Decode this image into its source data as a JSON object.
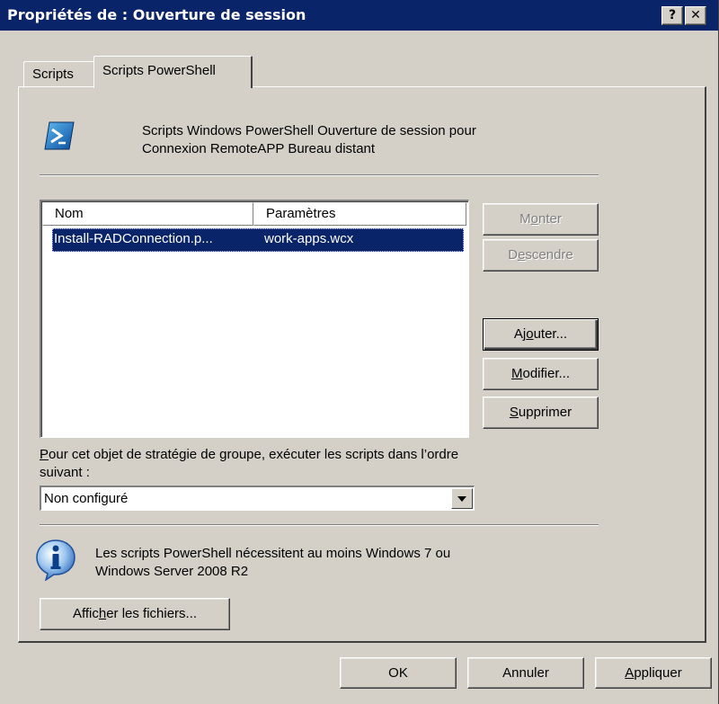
{
  "window": {
    "title": "Propriétés de : Ouverture de session",
    "help_glyph": "?",
    "close_glyph": "✕"
  },
  "tabs": [
    {
      "label": "Scripts",
      "selected": false
    },
    {
      "label": "Scripts PowerShell",
      "selected": true
    }
  ],
  "header": {
    "icon": "powershell-icon",
    "line1": "Scripts Windows PowerShell Ouverture de session pour",
    "line2": "Connexion RemoteAPP Bureau distant"
  },
  "list": {
    "columns": [
      "Nom",
      "Paramètres"
    ],
    "rows": [
      {
        "name": "Install-RADConnection.p...",
        "params": "work-apps.wcx",
        "selected": true
      }
    ]
  },
  "side_buttons": {
    "monter": {
      "pre": "M",
      "key": "o",
      "post": "nter",
      "enabled": false
    },
    "descendre": {
      "pre": "D",
      "key": "e",
      "post": "scendre",
      "enabled": false
    },
    "ajouter": {
      "pre": "Aj",
      "key": "o",
      "post": "uter...",
      "enabled": true
    },
    "modifier": {
      "pre": "",
      "key": "M",
      "post": "odifier...",
      "enabled": true
    },
    "supprimer": {
      "pre": "",
      "key": "S",
      "post": "upprimer",
      "enabled": true
    }
  },
  "order": {
    "label_key": "P",
    "label_rest": "our cet objet de stratégie de groupe, exécuter les scripts dans l’ordre",
    "label_line2": "suivant :",
    "selected": "Non configuré"
  },
  "info": {
    "icon": "info-icon",
    "line1": "Les scripts PowerShell nécessitent au moins Windows 7 ou",
    "line2": "Windows Server 2008 R2"
  },
  "show_files": {
    "pre": "Affic",
    "key": "h",
    "post": "er les fichiers..."
  },
  "footer": {
    "ok": "OK",
    "cancel": "Annuler",
    "apply_key": "A",
    "apply_rest": "ppliquer"
  },
  "colors": {
    "titlebar": "#0a246a",
    "face": "#d4d0c8",
    "selection": "#0a246a"
  }
}
